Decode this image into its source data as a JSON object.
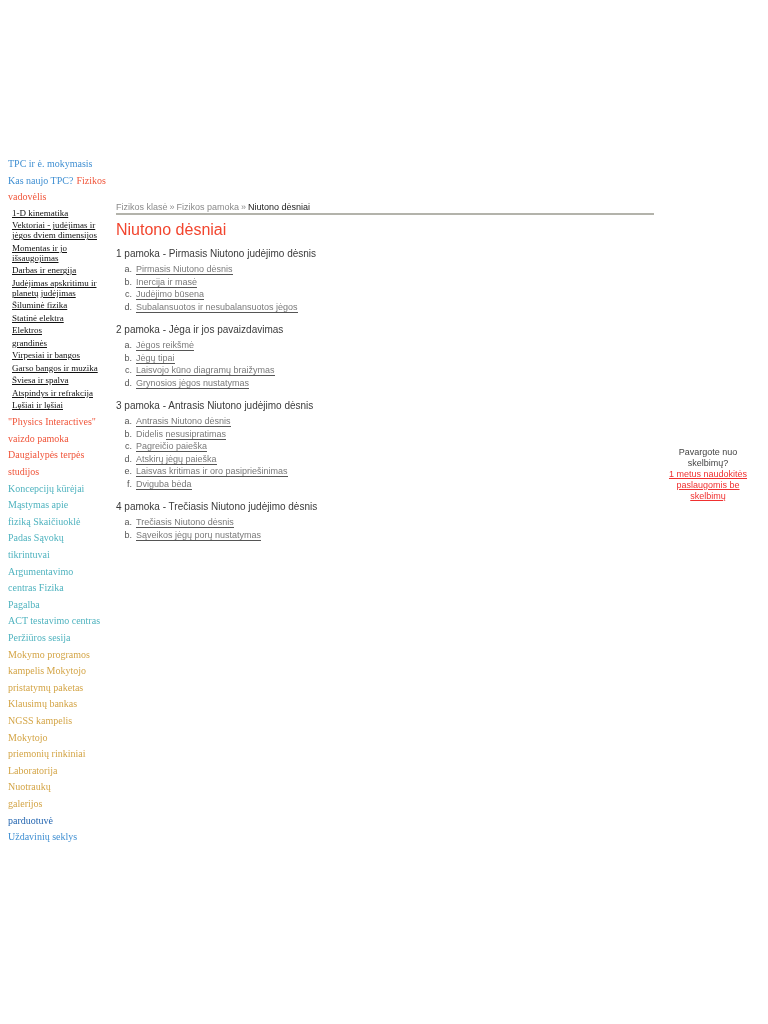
{
  "sidebar": {
    "top_lines": [
      {
        "links": [
          {
            "text": "TPC ir ė. mokymasis",
            "kind": "tpc"
          }
        ]
      },
      {
        "links": [
          {
            "text": "Kas naujo TPC?",
            "kind": "tpc"
          },
          {
            "text": "Fizikos",
            "kind": "textbook"
          }
        ]
      },
      {
        "links": [
          {
            "text": "vadovėlis",
            "kind": "textbook"
          }
        ]
      }
    ],
    "topics": [
      "1-D kinematika",
      "Vektoriai - judėjimas ir jėgos dviem dimensijos",
      "Momentas ir jo išsaugojimas",
      "Darbas ir energija",
      "Judėjimas apskritimu ir planetų judėjimas",
      "Šiluminė fizika",
      "Statinė elektra",
      "Elektros",
      "grandinės",
      "Virpesiai ir bangos",
      "Garso bangos ir muzika",
      "Šviesa ir spalva",
      "Atspindys ir refrakcija",
      "Lęšiai ir lęšiai"
    ],
    "bottom_lines": [
      {
        "text": "\"Physics Interactives\"",
        "kind": "multimedia"
      },
      {
        "text": "vaizdo pamoka",
        "kind": "multimedia"
      },
      {
        "text": "Daugialypės terpės",
        "kind": "multimedia"
      },
      {
        "text": "studijos",
        "kind": "multimedia"
      },
      {
        "text": "Koncepcijų kūrėjai",
        "kind": "concepts"
      },
      {
        "text": "Mąstymas apie",
        "kind": "concepts"
      },
      {
        "text": "fiziką Skaičiuoklė",
        "kind": "concepts"
      },
      {
        "text": "Padas Sąvokų",
        "kind": "concepts"
      },
      {
        "text": "tikrintuvai",
        "kind": "concepts"
      },
      {
        "text": "Argumentavimo",
        "kind": "concepts"
      },
      {
        "text": "centras Fizika",
        "kind": "concepts"
      },
      {
        "text": "Pagalba",
        "kind": "concepts"
      },
      {
        "text": "ACT testavimo centras",
        "kind": "concepts"
      },
      {
        "text": "Peržiūros sesija",
        "kind": "concepts"
      },
      {
        "text": "Mokymo programos",
        "kind": "teacher"
      },
      {
        "text": "kampelis Mokytojo",
        "kind": "teacher"
      },
      {
        "text": "pristatymų paketas",
        "kind": "teacher"
      },
      {
        "text": "Klausimų bankas",
        "kind": "teacher"
      },
      {
        "text": "NGSS kampelis",
        "kind": "teacher"
      },
      {
        "text": "Mokytojo",
        "kind": "teacher"
      },
      {
        "text": "priemonių rinkiniai",
        "kind": "teacher"
      },
      {
        "text": "Laboratorija",
        "kind": "teacher"
      },
      {
        "text": "Nuotraukų",
        "kind": "teacher"
      },
      {
        "text": "galerijos",
        "kind": "teacher"
      },
      {
        "text": "parduotuvė",
        "kind": "shop"
      },
      {
        "text": "Uždavinių seklys",
        "kind": "tpc"
      }
    ]
  },
  "breadcrumb": [
    {
      "text": "Fizikos klasė",
      "kind": "link"
    },
    {
      "text": "»",
      "kind": "separator"
    },
    {
      "text": "Fizikos pamoka",
      "kind": "link"
    },
    {
      "text": "»",
      "kind": "separator"
    },
    {
      "text": "Niutono dėsniai",
      "kind": "current"
    }
  ],
  "title": "Niutono dėsniai",
  "lessons": [
    {
      "heading": "1 pamoka - Pirmasis Niutono judėjimo dėsnis",
      "items": [
        {
          "marker": "a.",
          "link": "Pirmasis Niutono dėsnis"
        },
        {
          "marker": "b.",
          "link": "Inercija ir masė"
        },
        {
          "marker": "c.",
          "link": "Judėjimo būsena"
        },
        {
          "marker": "d.",
          "link": "Subalansuotos ir nesubalansuotos jėgos"
        }
      ]
    },
    {
      "heading": "2 pamoka - Jėga ir jos pavaizdavimas",
      "items": [
        {
          "marker": "a.",
          "link": "Jėgos reikšmė"
        },
        {
          "marker": "b.",
          "link": "Jėgų tipai"
        },
        {
          "marker": "c.",
          "link": "Laisvojo kūno diagramų braižymas"
        },
        {
          "marker": "d.",
          "link": "Grynosios jėgos nustatymas"
        }
      ]
    },
    {
      "heading": "3 pamoka - Antrasis Niutono judėjimo dėsnis",
      "items": [
        {
          "marker": "a.",
          "link": "Antrasis Niutono dėsnis"
        },
        {
          "marker": "b.",
          "prefix": "Didelis",
          "link": "nesusipratimas"
        },
        {
          "marker": "c.",
          "link": "Pagreičio paieška"
        },
        {
          "marker": "d.",
          "link": "Atskirų jėgų paieška"
        },
        {
          "marker": "e.",
          "link": "Laisvas kritimas ir oro pasipriešinimas"
        },
        {
          "marker": "f.",
          "link": "Dviguba bėda"
        }
      ]
    },
    {
      "heading": "4 pamoka - Trečiasis Niutono judėjimo dėsnis",
      "items": [
        {
          "marker": "a.",
          "link": "Trečiasis Niutono dėsnis"
        },
        {
          "marker": "b.",
          "link": "Sąveikos jėgų porų nustatymas"
        }
      ]
    }
  ],
  "ad": {
    "prompt": "Pavargote nuo skelbimų?",
    "link": "1 metus naudokitės paslaugomis be skelbimų"
  }
}
